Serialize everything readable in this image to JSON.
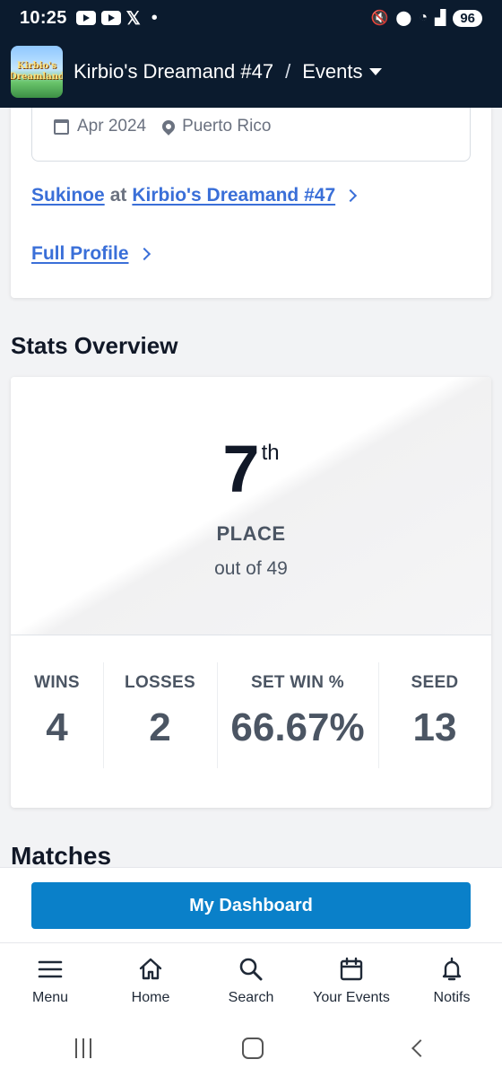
{
  "status_bar": {
    "time": "10:25",
    "battery": "96"
  },
  "header": {
    "event_name": "Kirbio's Dreamand #47",
    "separator": "/",
    "section": "Events",
    "logo_text_line1": "Kirbio's",
    "logo_text_line2": "Dreamland"
  },
  "event_meta": {
    "date": "Apr 2024",
    "location": "Puerto Rico"
  },
  "links": {
    "player": "Sukinoe",
    "at": "at",
    "event": "Kirbio's Dreamand #47",
    "full_profile": "Full Profile"
  },
  "stats_overview": {
    "title": "Stats Overview",
    "place_number": "7",
    "place_suffix": "th",
    "place_label": "PLACE",
    "out_of": "out of 49",
    "stats": [
      {
        "label": "WINS",
        "value": "4"
      },
      {
        "label": "LOSSES",
        "value": "2"
      },
      {
        "label": "SET WIN %",
        "value": "66.67%"
      },
      {
        "label": "SEED",
        "value": "13"
      }
    ]
  },
  "matches": {
    "title": "Matches"
  },
  "dashboard_button": "My Dashboard",
  "bottom_nav": [
    {
      "label": "Menu",
      "icon": "menu-icon"
    },
    {
      "label": "Home",
      "icon": "home-icon"
    },
    {
      "label": "Search",
      "icon": "search-icon"
    },
    {
      "label": "Your Events",
      "icon": "calendar-icon"
    },
    {
      "label": "Notifs",
      "icon": "bell-icon"
    }
  ],
  "colors": {
    "header_bg": "#0b1b2e",
    "link": "#3a6fd8",
    "button": "#0a80c9"
  }
}
